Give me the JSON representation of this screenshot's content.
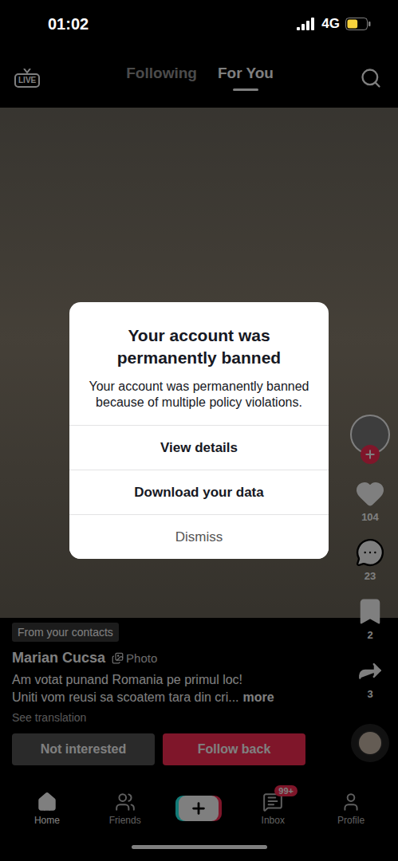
{
  "status_bar": {
    "time": "01:02",
    "network": "4G",
    "signal": {
      "level": 1
    },
    "battery": {
      "level": 0.55
    }
  },
  "top_nav": {
    "live_label": "LIVE",
    "tabs": [
      {
        "label": "Following",
        "selected": false
      },
      {
        "label": "For You",
        "selected": true
      }
    ]
  },
  "post": {
    "contact_chip": "From your contacts",
    "author": "Marian Cucsa",
    "type_tag": "Photo",
    "caption_lines": [
      "Am votat punand Romania pe primul loc!",
      "Uniti vom reusi sa scoatem tara din cri..."
    ],
    "more": "more",
    "see_translation": "See translation",
    "buttons": [
      {
        "label": "Not interested",
        "kind": "secondary"
      },
      {
        "label": "Follow back",
        "kind": "primary"
      }
    ]
  },
  "actions": [
    {
      "kind": "like",
      "count": "104"
    },
    {
      "kind": "comment",
      "count": "23"
    },
    {
      "kind": "bookmark",
      "count": "2"
    },
    {
      "kind": "share",
      "count": "3"
    }
  ],
  "bottom_nav": [
    {
      "kind": "home",
      "label": "Home",
      "selected": true
    },
    {
      "kind": "friends",
      "label": "Friends",
      "selected": false
    },
    {
      "kind": "create",
      "label": "",
      "selected": false
    },
    {
      "kind": "inbox",
      "label": "Inbox",
      "selected": false,
      "badge": "99+"
    },
    {
      "kind": "profile",
      "label": "Profile",
      "selected": false
    }
  ],
  "dialog": {
    "title": "Your account was permanently banned",
    "message": "Your account was permanently banned because of multiple policy violations.",
    "actions": [
      {
        "label": "View details",
        "kind": "primary"
      },
      {
        "label": "Download your data",
        "kind": "primary"
      },
      {
        "label": "Dismiss",
        "kind": "cancel"
      }
    ]
  }
}
